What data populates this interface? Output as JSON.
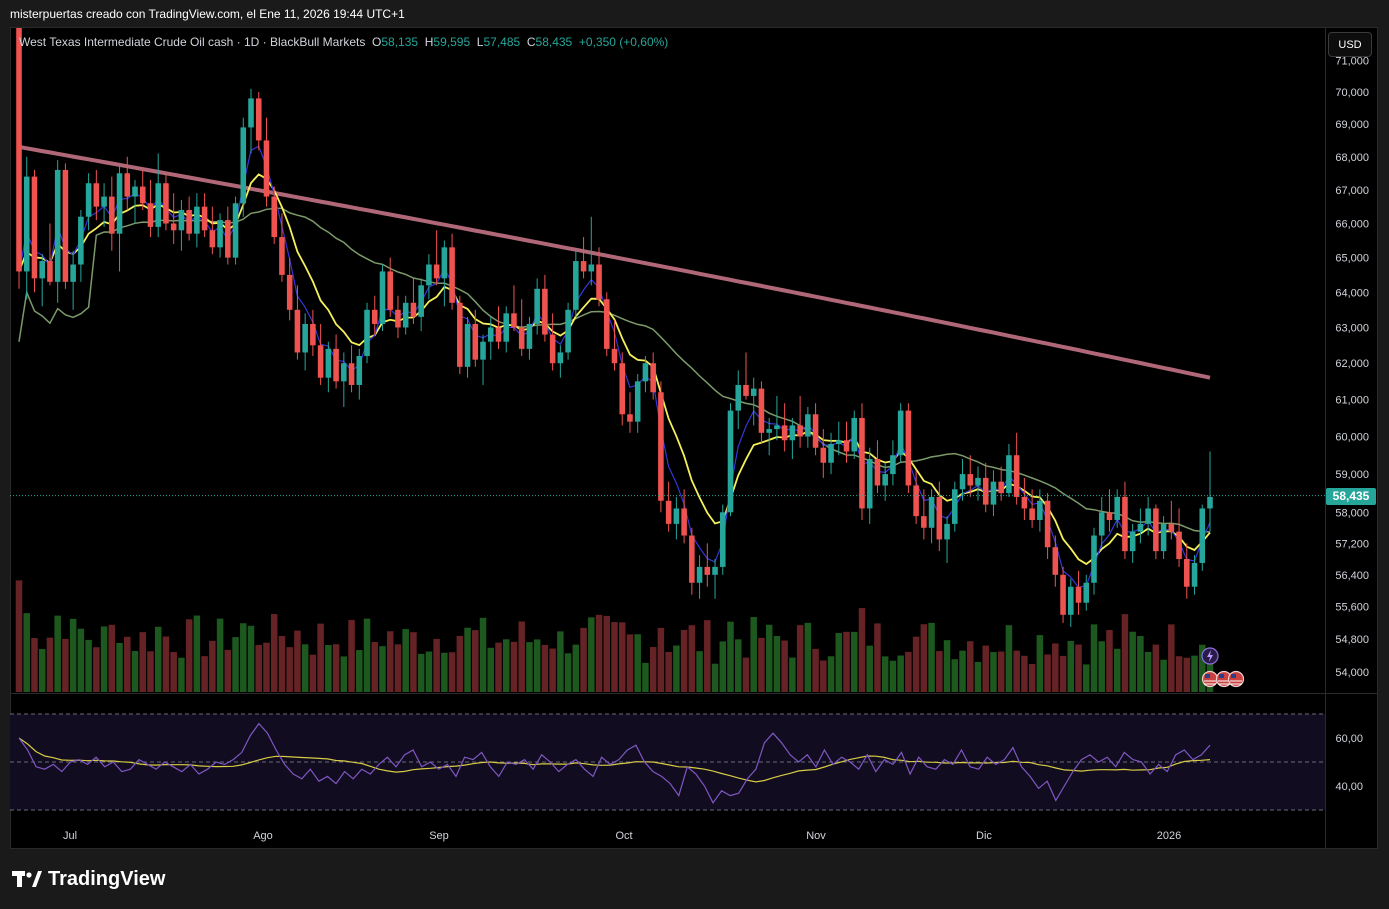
{
  "header": {
    "text": "misterpuertas creado con TradingView.com, el Ene 11, 2026 19:44 UTC+1"
  },
  "legend": {
    "symbol": "West Texas Intermediate Crude Oil cash · 1D · BlackBull Markets",
    "o_label": "O",
    "o": "58,135",
    "h_label": "H",
    "h": "59,595",
    "l_label": "L",
    "l": "57,485",
    "c_label": "C",
    "c": "58,435",
    "change": "+0,350 (+0,60%)"
  },
  "currency": "USD",
  "last_price": "58,435",
  "brand": "TradingView",
  "colors": {
    "up": "#26a69a",
    "down": "#ef5350",
    "ema_fast": "#3636d8",
    "ema_mid": "#f5f05a",
    "sma_slow": "#7c9a6a",
    "sma_long": "#b06878",
    "rsi": "#7e57c2",
    "rsi_ma": "#d6cb45",
    "background": "#000000"
  },
  "chart_data": {
    "type": "candlestick",
    "price_axis": {
      "ticks": [
        "71,000",
        "70,000",
        "69,000",
        "68,000",
        "67,000",
        "66,000",
        "65,000",
        "64,000",
        "63,000",
        "62,000",
        "61,000",
        "60,000",
        "59,000",
        "58,000",
        "57,200",
        "56,400",
        "55,600",
        "54,800",
        "54,000"
      ],
      "scale": "log"
    },
    "time_axis": {
      "labels": [
        "Jul",
        "Ago",
        "Sep",
        "Oct",
        "Nov",
        "Dic",
        "2026"
      ]
    },
    "rsi_axis": {
      "ticks": [
        "60,00",
        "40,00"
      ],
      "bands": [
        70,
        50,
        30
      ]
    },
    "candles": [
      [
        72.5,
        72.8,
        64.1,
        64.6
      ],
      [
        64.6,
        68.0,
        63.8,
        67.4
      ],
      [
        67.4,
        67.6,
        64.0,
        64.4
      ],
      [
        64.4,
        65.1,
        63.6,
        64.9
      ],
      [
        64.9,
        66.0,
        64.2,
        64.3
      ],
      [
        64.3,
        67.9,
        63.7,
        67.6
      ],
      [
        67.6,
        67.8,
        64.1,
        64.3
      ],
      [
        64.3,
        65.2,
        63.5,
        64.8
      ],
      [
        64.8,
        66.4,
        64.3,
        66.2
      ],
      [
        66.2,
        67.5,
        65.8,
        67.2
      ],
      [
        67.2,
        67.6,
        66.1,
        66.5
      ],
      [
        66.5,
        67.2,
        65.9,
        66.8
      ],
      [
        66.8,
        67.4,
        65.2,
        65.7
      ],
      [
        65.7,
        67.8,
        64.6,
        67.5
      ],
      [
        67.5,
        68.0,
        66.4,
        66.8
      ],
      [
        66.8,
        67.3,
        66.0,
        67.1
      ],
      [
        67.1,
        67.6,
        66.4,
        66.6
      ],
      [
        66.6,
        67.3,
        65.6,
        65.9
      ],
      [
        65.9,
        68.1,
        65.6,
        67.2
      ],
      [
        67.2,
        67.5,
        65.8,
        66.0
      ],
      [
        66.0,
        66.9,
        65.4,
        65.8
      ],
      [
        65.8,
        66.7,
        65.2,
        66.4
      ],
      [
        66.4,
        66.8,
        65.5,
        65.7
      ],
      [
        65.7,
        66.9,
        65.3,
        66.5
      ],
      [
        66.5,
        66.9,
        65.6,
        65.8
      ],
      [
        65.8,
        66.5,
        65.1,
        65.3
      ],
      [
        65.3,
        66.3,
        65.0,
        66.1
      ],
      [
        66.1,
        66.5,
        64.8,
        65.0
      ],
      [
        65.0,
        66.8,
        64.8,
        66.6
      ],
      [
        66.6,
        69.2,
        66.2,
        68.9
      ],
      [
        68.9,
        70.1,
        68.1,
        69.8
      ],
      [
        69.8,
        70.0,
        68.2,
        68.5
      ],
      [
        68.5,
        69.2,
        66.5,
        66.8
      ],
      [
        66.8,
        67.1,
        65.4,
        65.6
      ],
      [
        65.6,
        66.3,
        64.3,
        64.5
      ],
      [
        64.5,
        65.0,
        63.2,
        63.5
      ],
      [
        63.5,
        64.2,
        62.1,
        62.3
      ],
      [
        62.3,
        63.4,
        61.8,
        63.1
      ],
      [
        63.1,
        63.5,
        62.2,
        62.5
      ],
      [
        62.5,
        63.1,
        61.4,
        61.6
      ],
      [
        61.6,
        62.6,
        61.2,
        62.4
      ],
      [
        62.4,
        62.8,
        61.3,
        61.5
      ],
      [
        61.5,
        62.3,
        60.8,
        62.0
      ],
      [
        62.0,
        62.5,
        61.2,
        61.4
      ],
      [
        61.4,
        62.4,
        61.0,
        62.2
      ],
      [
        62.2,
        63.7,
        62.0,
        63.5
      ],
      [
        63.5,
        63.9,
        62.8,
        63.1
      ],
      [
        63.1,
        64.8,
        62.9,
        64.6
      ],
      [
        64.6,
        65.0,
        63.3,
        63.5
      ],
      [
        63.5,
        63.9,
        62.7,
        63.0
      ],
      [
        63.0,
        63.9,
        62.8,
        63.7
      ],
      [
        63.7,
        64.4,
        63.1,
        63.3
      ],
      [
        63.3,
        64.4,
        62.9,
        64.2
      ],
      [
        64.2,
        65.1,
        63.8,
        64.8
      ],
      [
        64.8,
        65.8,
        64.2,
        64.4
      ],
      [
        64.4,
        65.5,
        63.6,
        65.3
      ],
      [
        65.3,
        65.7,
        63.5,
        63.7
      ],
      [
        63.7,
        63.9,
        61.7,
        61.9
      ],
      [
        61.9,
        63.3,
        61.6,
        63.1
      ],
      [
        63.1,
        63.5,
        61.9,
        62.1
      ],
      [
        62.1,
        62.8,
        61.4,
        62.6
      ],
      [
        62.6,
        63.3,
        62.1,
        63.0
      ],
      [
        63.0,
        63.6,
        62.4,
        62.6
      ],
      [
        62.6,
        63.6,
        62.3,
        63.4
      ],
      [
        63.4,
        64.2,
        62.9,
        63.0
      ],
      [
        63.0,
        63.8,
        62.2,
        62.4
      ],
      [
        62.4,
        63.3,
        62.1,
        63.1
      ],
      [
        63.1,
        64.4,
        62.8,
        64.1
      ],
      [
        64.1,
        64.5,
        62.6,
        62.8
      ],
      [
        62.8,
        63.4,
        61.8,
        62.0
      ],
      [
        62.0,
        62.5,
        61.6,
        62.3
      ],
      [
        62.3,
        63.7,
        62.1,
        63.5
      ],
      [
        63.5,
        65.2,
        63.3,
        64.9
      ],
      [
        64.9,
        65.6,
        64.4,
        64.6
      ],
      [
        64.6,
        66.2,
        64.2,
        64.8
      ],
      [
        64.8,
        65.3,
        63.6,
        63.8
      ],
      [
        63.8,
        64.0,
        62.2,
        62.4
      ],
      [
        62.4,
        63.2,
        61.8,
        62.0
      ],
      [
        62.0,
        62.3,
        60.3,
        60.6
      ],
      [
        60.6,
        61.2,
        60.1,
        60.4
      ],
      [
        60.4,
        61.7,
        60.1,
        61.5
      ],
      [
        61.5,
        62.2,
        61.2,
        62.0
      ],
      [
        62.0,
        62.3,
        61.0,
        61.2
      ],
      [
        61.2,
        61.5,
        58.0,
        58.3
      ],
      [
        58.3,
        58.8,
        57.5,
        57.7
      ],
      [
        57.7,
        58.4,
        57.3,
        58.1
      ],
      [
        58.1,
        58.6,
        57.2,
        57.4
      ],
      [
        57.4,
        57.6,
        55.9,
        56.2
      ],
      [
        56.2,
        56.9,
        55.8,
        56.6
      ],
      [
        56.6,
        57.2,
        56.1,
        56.4
      ],
      [
        56.4,
        56.8,
        55.8,
        56.6
      ],
      [
        56.6,
        58.2,
        56.4,
        58.0
      ],
      [
        58.0,
        60.9,
        57.9,
        60.7
      ],
      [
        60.7,
        61.8,
        60.2,
        61.4
      ],
      [
        61.4,
        62.3,
        61.0,
        61.1
      ],
      [
        61.1,
        61.6,
        60.3,
        61.3
      ],
      [
        61.3,
        61.5,
        59.8,
        60.1
      ],
      [
        60.1,
        60.5,
        59.5,
        60.2
      ],
      [
        60.2,
        61.1,
        59.9,
        60.3
      ],
      [
        60.3,
        60.9,
        59.6,
        59.9
      ],
      [
        59.9,
        60.5,
        59.4,
        60.3
      ],
      [
        60.3,
        61.1,
        59.7,
        60.0
      ],
      [
        60.0,
        60.8,
        59.7,
        60.6
      ],
      [
        60.6,
        60.9,
        59.5,
        59.7
      ],
      [
        59.7,
        60.2,
        58.9,
        59.3
      ],
      [
        59.3,
        60.1,
        59.0,
        59.8
      ],
      [
        59.8,
        60.4,
        59.5,
        59.9
      ],
      [
        59.9,
        60.4,
        59.3,
        59.6
      ],
      [
        59.6,
        60.7,
        59.4,
        60.5
      ],
      [
        60.5,
        60.9,
        57.8,
        58.1
      ],
      [
        58.1,
        59.7,
        57.7,
        59.4
      ],
      [
        59.4,
        59.9,
        58.5,
        58.7
      ],
      [
        58.7,
        59.3,
        58.3,
        59.0
      ],
      [
        59.0,
        59.9,
        58.7,
        59.5
      ],
      [
        59.5,
        60.9,
        59.3,
        60.7
      ],
      [
        60.7,
        60.9,
        58.5,
        58.7
      ],
      [
        58.7,
        59.1,
        57.7,
        57.9
      ],
      [
        57.9,
        58.6,
        57.3,
        57.6
      ],
      [
        57.6,
        58.6,
        57.2,
        58.4
      ],
      [
        58.4,
        58.8,
        57.0,
        57.3
      ],
      [
        57.3,
        57.9,
        56.7,
        57.7
      ],
      [
        57.7,
        58.8,
        57.5,
        58.6
      ],
      [
        58.6,
        59.4,
        58.3,
        59.0
      ],
      [
        59.0,
        59.5,
        58.4,
        58.7
      ],
      [
        58.7,
        59.2,
        58.3,
        58.9
      ],
      [
        58.9,
        59.3,
        58.0,
        58.2
      ],
      [
        58.2,
        59.1,
        57.9,
        58.8
      ],
      [
        58.8,
        59.2,
        58.3,
        58.5
      ],
      [
        58.5,
        59.8,
        58.4,
        59.5
      ],
      [
        59.5,
        60.1,
        58.2,
        58.4
      ],
      [
        58.4,
        58.9,
        57.8,
        58.1
      ],
      [
        58.1,
        58.6,
        57.6,
        57.8
      ],
      [
        57.8,
        58.6,
        57.5,
        58.3
      ],
      [
        58.3,
        58.5,
        56.8,
        57.1
      ],
      [
        57.1,
        57.4,
        56.1,
        56.4
      ],
      [
        56.4,
        56.6,
        55.2,
        55.4
      ],
      [
        55.4,
        56.3,
        55.1,
        56.1
      ],
      [
        56.1,
        56.5,
        55.4,
        55.7
      ],
      [
        55.7,
        56.4,
        55.5,
        56.2
      ],
      [
        56.2,
        57.6,
        55.9,
        57.4
      ],
      [
        57.4,
        58.4,
        57.1,
        58.0
      ],
      [
        58.0,
        58.6,
        57.5,
        57.8
      ],
      [
        57.8,
        58.6,
        57.6,
        58.4
      ],
      [
        58.4,
        58.8,
        56.8,
        57.0
      ],
      [
        57.0,
        57.7,
        56.7,
        57.5
      ],
      [
        57.5,
        58.1,
        57.2,
        57.7
      ],
      [
        57.7,
        58.4,
        57.4,
        58.1
      ],
      [
        58.1,
        58.2,
        56.8,
        57.0
      ],
      [
        57.0,
        57.9,
        56.8,
        57.7
      ],
      [
        57.7,
        58.3,
        57.3,
        57.5
      ],
      [
        57.5,
        58.1,
        56.6,
        56.8
      ],
      [
        56.8,
        57.2,
        55.8,
        56.1
      ],
      [
        56.1,
        56.9,
        55.9,
        56.7
      ],
      [
        56.7,
        58.2,
        56.5,
        58.1
      ],
      [
        58.1,
        59.6,
        57.5,
        58.4
      ]
    ],
    "rsi_series": [
      60,
      55,
      48,
      47,
      49,
      46,
      50,
      51,
      49,
      52,
      48,
      50,
      46,
      47,
      51,
      49,
      47,
      50,
      48,
      46,
      49,
      45,
      47,
      50,
      49,
      51,
      54,
      61,
      66,
      62,
      55,
      49,
      45,
      43,
      47,
      42,
      44,
      41,
      46,
      43,
      47,
      45,
      49,
      52,
      48,
      53,
      55,
      48,
      50,
      47,
      49,
      44,
      52,
      51,
      54,
      48,
      44,
      50,
      49,
      51,
      47,
      53,
      50,
      46,
      49,
      51,
      47,
      44,
      52,
      49,
      51,
      55,
      57,
      50,
      46,
      44,
      41,
      36,
      48,
      45,
      40,
      33,
      38,
      36,
      37,
      43,
      47,
      58,
      62,
      58,
      53,
      50,
      53,
      48,
      55,
      49,
      52,
      50,
      47,
      53,
      46,
      51,
      49,
      54,
      45,
      52,
      48,
      47,
      51,
      49,
      55,
      48,
      47,
      52,
      49,
      51,
      56,
      48,
      44,
      39,
      42,
      34,
      40,
      46,
      51,
      53,
      50,
      52,
      48,
      54,
      51,
      50,
      45,
      49,
      46,
      53,
      55,
      51,
      53,
      57
    ]
  }
}
